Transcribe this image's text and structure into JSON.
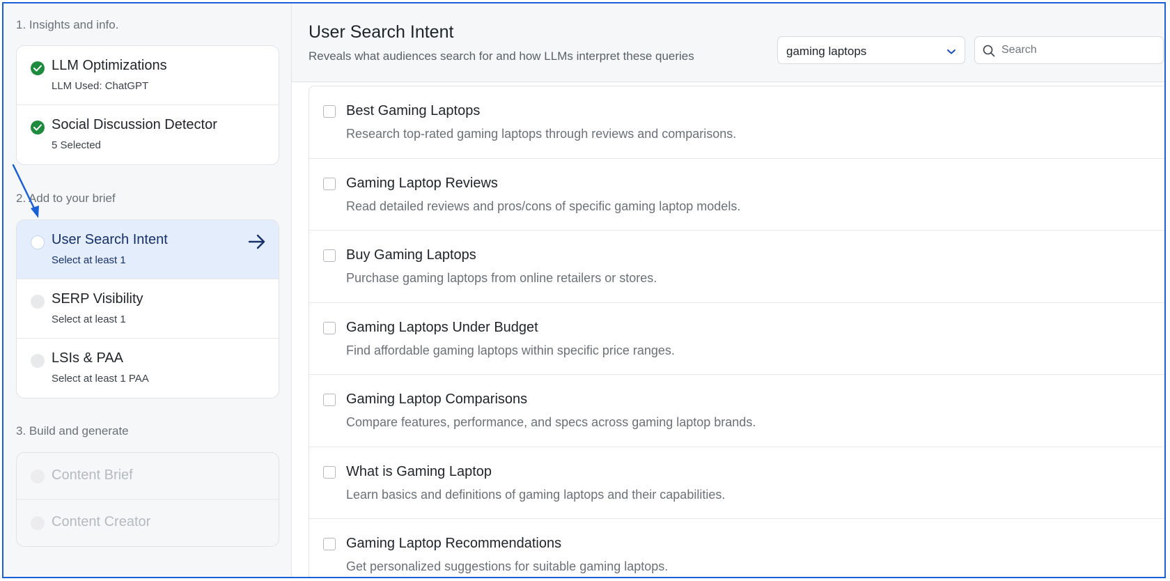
{
  "sidebar": {
    "section1_title": "1. Insights and info.",
    "section2_title": "2. Add to your brief",
    "section3_title": "3. Build and generate",
    "completed": [
      {
        "title": "LLM Optimizations",
        "sub": "LLM Used: ChatGPT"
      },
      {
        "title": "Social Discussion Detector",
        "sub": "5 Selected"
      }
    ],
    "brief": [
      {
        "title": "User Search Intent",
        "sub": "Select at least 1"
      },
      {
        "title": "SERP Visibility",
        "sub": "Select at least 1"
      },
      {
        "title": "LSIs & PAA",
        "sub": "Select at least 1 PAA"
      }
    ],
    "build": [
      {
        "title": "Content Brief"
      },
      {
        "title": "Content Creator"
      }
    ]
  },
  "header": {
    "title": "User Search Intent",
    "subtitle": "Reveals what audiences search for and how LLMs interpret these queries",
    "select_value": "gaming laptops",
    "search_placeholder": "Search"
  },
  "intents": [
    {
      "title": "Best Gaming Laptops",
      "desc": "Research top-rated gaming laptops through reviews and comparisons."
    },
    {
      "title": "Gaming Laptop Reviews",
      "desc": "Read detailed reviews and pros/cons of specific gaming laptop models."
    },
    {
      "title": "Buy Gaming Laptops",
      "desc": "Purchase gaming laptops from online retailers or stores."
    },
    {
      "title": "Gaming Laptops Under Budget",
      "desc": "Find affordable gaming laptops within specific price ranges."
    },
    {
      "title": "Gaming Laptop Comparisons",
      "desc": "Compare features, performance, and specs across gaming laptop brands."
    },
    {
      "title": "What is Gaming Laptop",
      "desc": "Learn basics and definitions of gaming laptops and their capabilities."
    },
    {
      "title": "Gaming Laptop Recommendations",
      "desc": "Get personalized suggestions for suitable gaming laptops."
    }
  ],
  "colors": {
    "accent": "#1a5fd6",
    "success": "#1f8b3e",
    "active_bg": "#e4edfb"
  }
}
